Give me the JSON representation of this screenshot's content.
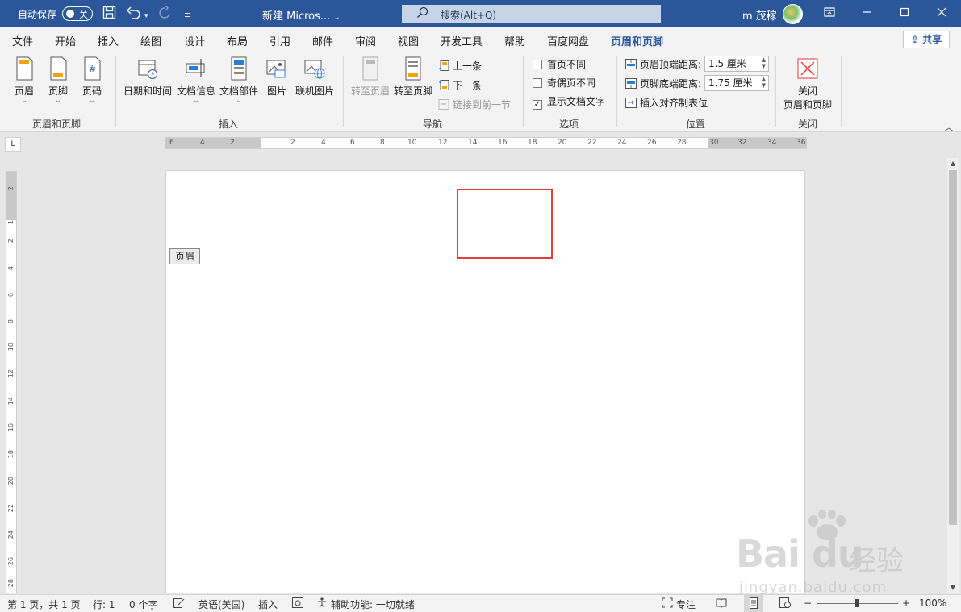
{
  "titlebar": {
    "autosave_label": "自动保存",
    "autosave_state": "关",
    "doc_title": "新建 Micros...",
    "doc_title_caret": "⌄",
    "search_text": "搜索(Alt+Q)",
    "user_name": "m 茂稼",
    "icons": [
      "save-icon",
      "undo-icon",
      "redo-icon",
      "customize-icon",
      "ribbon-display-icon",
      "minimize-icon",
      "maximize-icon",
      "close-icon"
    ]
  },
  "tabs": [
    {
      "label": "文件"
    },
    {
      "label": "开始"
    },
    {
      "label": "插入"
    },
    {
      "label": "绘图"
    },
    {
      "label": "设计"
    },
    {
      "label": "布局"
    },
    {
      "label": "引用"
    },
    {
      "label": "邮件"
    },
    {
      "label": "审阅"
    },
    {
      "label": "视图"
    },
    {
      "label": "开发工具"
    },
    {
      "label": "帮助"
    },
    {
      "label": "百度网盘"
    },
    {
      "label": "页眉和页脚",
      "active": true
    }
  ],
  "share_label": "共享",
  "ribbon": {
    "group1": {
      "label": "页眉和页脚",
      "buttons": [
        "页眉",
        "页脚",
        "页码"
      ]
    },
    "group2": {
      "label": "插入",
      "buttons": [
        "日期和时间",
        "文档信息",
        "文档部件",
        "图片",
        "联机图片"
      ]
    },
    "group3": {
      "label": "导航",
      "big": [
        "转至页眉",
        "转至页脚"
      ],
      "small": [
        "上一条",
        "下一条",
        "链接到前一节"
      ]
    },
    "group4": {
      "label": "选项",
      "checks": [
        {
          "label": "首页不同",
          "checked": false
        },
        {
          "label": "奇偶页不同",
          "checked": false
        },
        {
          "label": "显示文档文字",
          "checked": true
        }
      ]
    },
    "group5": {
      "label": "位置",
      "header_distance_label": "页眉顶端距离:",
      "header_distance_value": "1.5 厘米",
      "footer_distance_label": "页脚底端距离:",
      "footer_distance_value": "1.75 厘米",
      "align_tab_label": "插入对齐制表位"
    },
    "group6": {
      "label": "关闭",
      "close_line1": "关闭",
      "close_line2": "页眉和页脚"
    }
  },
  "ruler": {
    "h_numbers": [
      "6",
      "4",
      "2",
      "2",
      "4",
      "6",
      "8",
      "10",
      "12",
      "14",
      "16",
      "18",
      "20",
      "22",
      "24",
      "26",
      "28",
      "30",
      "32",
      "34",
      "36"
    ],
    "v_numbers": [
      "2",
      "1",
      "2",
      "4",
      "6",
      "8",
      "10",
      "12",
      "14",
      "16",
      "18",
      "20",
      "22",
      "24",
      "26",
      "28"
    ],
    "corner": "L"
  },
  "page": {
    "header_tag": "页眉"
  },
  "statusbar": {
    "page_info": "第 1 页，共 1 页",
    "line_info": "行: 1",
    "word_count": "0 个字",
    "language": "英语(美国)",
    "mode": "插入",
    "accessibility": "辅助功能: 一切就绪",
    "focus": "专注",
    "zoom_minus": "−",
    "zoom_plus": "+",
    "zoom_level": "100%"
  },
  "watermark": {
    "logo": "Bai du",
    "cn": "经验",
    "url": "jingyan.baidu.com"
  }
}
